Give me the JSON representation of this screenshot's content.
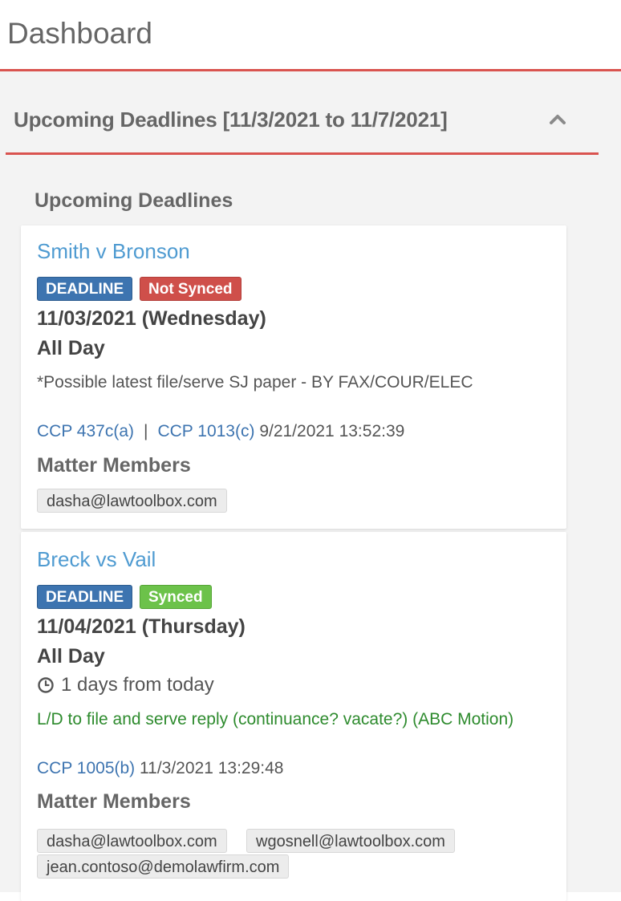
{
  "page": {
    "title": "Dashboard"
  },
  "panel": {
    "title": "Upcoming Deadlines [11/3/2021 to 11/7/2021]",
    "collapse_icon": "chevron-up-icon",
    "section_label": "Upcoming Deadlines"
  },
  "colors": {
    "accent_red": "#d9534f",
    "link_blue": "#4f9bd1",
    "deadline_badge": "#3d74b0",
    "not_synced_badge": "#cf4f4a",
    "synced_badge": "#6cc24a",
    "description_green": "#2e8b2e"
  },
  "deadlines": [
    {
      "matter": "Smith v Bronson",
      "type_badge": "DEADLINE",
      "sync_badge": "Not Synced",
      "date": "11/03/2021 (Wednesday)",
      "time": "All Day",
      "description": "*Possible latest file/serve SJ paper - BY FAX/COUR/ELEC",
      "rules": [
        "CCP 437c(a)",
        "CCP 1013(c)"
      ],
      "rule_separator": "|",
      "timestamp": "9/21/2021 13:52:39",
      "members_label": "Matter Members",
      "members": [
        "dasha@lawtoolbox.com"
      ]
    },
    {
      "matter": "Breck vs Vail",
      "type_badge": "DEADLINE",
      "sync_badge": "Synced",
      "date": "11/04/2021 (Thursday)",
      "time": "All Day",
      "relative": "1 days from today",
      "relative_icon": "clock-icon",
      "description": "L/D to file and serve reply (continuance? vacate?) (ABC Motion)",
      "rules": [
        "CCP 1005(b)"
      ],
      "timestamp": "11/3/2021 13:29:48",
      "members_label": "Matter Members",
      "members": [
        "dasha@lawtoolbox.com",
        "wgosnell@lawtoolbox.com",
        "jean.contoso@demolawfirm.com"
      ]
    }
  ]
}
